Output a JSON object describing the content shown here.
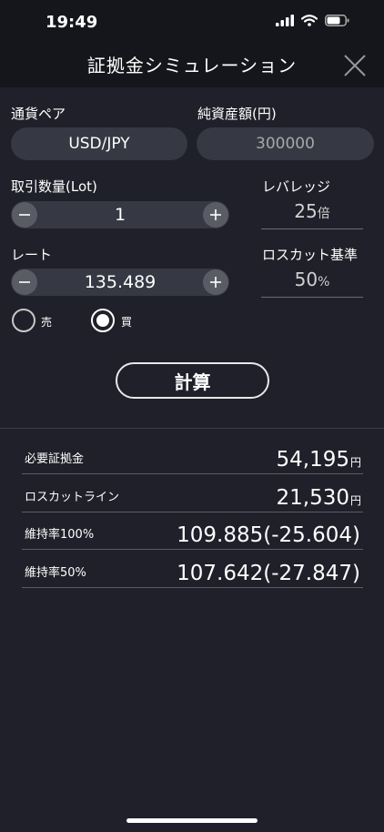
{
  "status_bar": {
    "time": "19:49"
  },
  "header": {
    "title": "証拠金シミュレーション"
  },
  "currency_pair": {
    "label": "通貨ペア",
    "value": "USD/JPY"
  },
  "net_assets": {
    "label": "純資産額(円)",
    "placeholder": "300000"
  },
  "quantity": {
    "label": "取引数量(Lot)",
    "value": "1"
  },
  "leverage": {
    "label": "レバレッジ",
    "value": "25",
    "unit": "倍"
  },
  "rate": {
    "label": "レート",
    "value": "135.489"
  },
  "losscut_threshold": {
    "label": "ロスカット基準",
    "value": "50",
    "unit": "%"
  },
  "side": {
    "sell_label": "売",
    "buy_label": "買",
    "selected": "buy"
  },
  "calc_button": {
    "label": "計算"
  },
  "results": [
    {
      "label": "必要証拠金",
      "value": "54,195",
      "unit": "円"
    },
    {
      "label": "ロスカットライン",
      "value": "21,530",
      "unit": "円"
    },
    {
      "label": "維持率100%",
      "value": "109.885(-25.604)",
      "unit": ""
    },
    {
      "label": "維持率50%",
      "value": "107.642(-27.847)",
      "unit": ""
    }
  ],
  "colors": {
    "background": "#1f2029",
    "header": "#15161b",
    "field": "#363843",
    "step_button": "#5a5c65"
  },
  "icons": {
    "close": "close-icon",
    "minus": "minus-icon",
    "plus": "plus-icon"
  }
}
